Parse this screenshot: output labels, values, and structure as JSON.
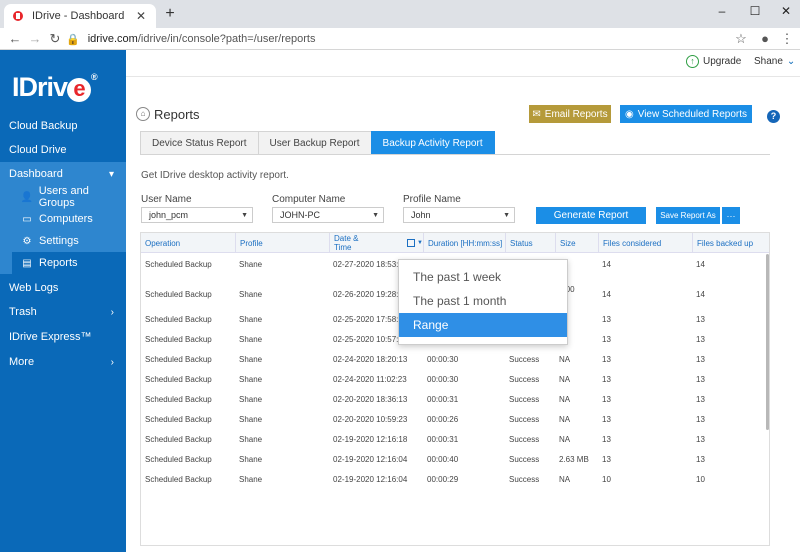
{
  "browser": {
    "tab_title": "IDrive - Dashboard",
    "tab_close": "✕",
    "new_tab": "+",
    "url_host": "idrive.com",
    "url_path": "/idrive/in/console?path=/user/reports",
    "window_controls": [
      "–",
      "☐",
      "✕"
    ]
  },
  "sidebar": {
    "logo_text": "IDriv",
    "logo_e": "e",
    "logo_reg": "®",
    "items": [
      {
        "label": "Cloud Backup"
      },
      {
        "label": "Cloud Drive"
      },
      {
        "label": "Dashboard"
      },
      {
        "label": "Web Logs"
      },
      {
        "label": "Trash"
      },
      {
        "label": "IDrive Express™"
      },
      {
        "label": "More"
      }
    ],
    "sub_items": [
      {
        "label": "Users and Groups",
        "icon": "users-icon"
      },
      {
        "label": "Computers",
        "icon": "computer-icon"
      },
      {
        "label": "Settings",
        "icon": "gear-icon"
      },
      {
        "label": "Reports",
        "icon": "report-icon"
      }
    ],
    "accent": "#0a69b8"
  },
  "header": {
    "upgrade_label": "Upgrade",
    "user_name": "Shane"
  },
  "page": {
    "title": "Reports",
    "email_reports": "Email Reports",
    "view_scheduled": "View Scheduled Reports",
    "help": "?",
    "tabs": [
      {
        "label": "Device Status Report"
      },
      {
        "label": "User Backup Report"
      },
      {
        "label": "Backup Activity Report"
      }
    ],
    "description": "Get IDrive desktop activity report.",
    "filters": {
      "user_label": "User Name",
      "user_value": "john_pcm",
      "computer_label": "Computer Name",
      "computer_value": "JOHN-PC",
      "profile_label": "Profile Name",
      "profile_value": "John"
    },
    "generate": "Generate Report",
    "save_as": "Save Report As",
    "more": "···"
  },
  "table": {
    "columns": [
      "Operation",
      "Profile",
      "Date & Time",
      "Duration [HH:mm:ss]",
      "Status",
      "Size",
      "Files considered",
      "Files backed up"
    ],
    "rows": [
      [
        "Scheduled Backup",
        "Shane",
        "02-27-2020 18:53:",
        "",
        "",
        "",
        "14",
        "14"
      ],
      [
        "Scheduled Backup",
        "Shane",
        "02-26-2020 19:28:0",
        "",
        "",
        "3.00",
        "14",
        "14"
      ],
      [
        "Scheduled Backup",
        "Shane",
        "02-25-2020 17:58:4",
        "",
        "",
        "",
        "13",
        "13"
      ],
      [
        "Scheduled Backup",
        "Shane",
        "02-25-2020 10:57:5",
        "",
        "",
        "",
        "13",
        "13"
      ],
      [
        "Scheduled Backup",
        "Shane",
        "02-24-2020 18:20:13",
        "00:00:30",
        "Success",
        "NA",
        "13",
        "13"
      ],
      [
        "Scheduled Backup",
        "Shane",
        "02-24-2020 11:02:23",
        "00:00:30",
        "Success",
        "NA",
        "13",
        "13"
      ],
      [
        "Scheduled Backup",
        "Shane",
        "02-20-2020 18:36:13",
        "00:00:31",
        "Success",
        "NA",
        "13",
        "13"
      ],
      [
        "Scheduled Backup",
        "Shane",
        "02-20-2020 10:59:23",
        "00:00:26",
        "Success",
        "NA",
        "13",
        "13"
      ],
      [
        "Scheduled Backup",
        "Shane",
        "02-19-2020 12:16:18",
        "00:00:31",
        "Success",
        "NA",
        "13",
        "13"
      ],
      [
        "Scheduled Backup",
        "Shane",
        "02-19-2020 12:16:04",
        "00:00:40",
        "Success",
        "2.63 MB",
        "13",
        "13"
      ],
      [
        "Scheduled Backup",
        "Shane",
        "02-19-2020 12:16:04",
        "00:00:29",
        "Success",
        "NA",
        "10",
        "10"
      ]
    ],
    "partial_size_unit": "es"
  },
  "date_dropdown": {
    "options": [
      "The past 1 week",
      "The past 1 month",
      "Range"
    ],
    "selected": "Range"
  }
}
